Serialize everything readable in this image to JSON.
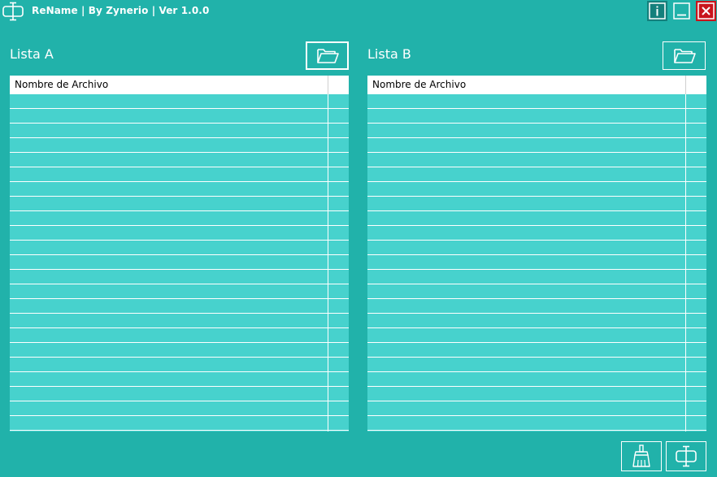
{
  "window": {
    "title": "ReName | By Zynerio | Ver 1.0.0",
    "controls": {
      "info": "info-icon",
      "minimize": "minimize-icon",
      "close": "close-icon"
    }
  },
  "list_a": {
    "title": "Lista A",
    "open_button_icon": "folder-open-icon",
    "columns": [
      "Nombre de Archivo",
      ""
    ],
    "rows": []
  },
  "list_b": {
    "title": "Lista B",
    "open_button_icon": "folder-open-icon",
    "columns": [
      "Nombre de Archivo",
      ""
    ],
    "rows": []
  },
  "footer": {
    "clear_button_icon": "broom-icon",
    "rename_button_icon": "rename-icon"
  },
  "colors": {
    "background": "#21b2aa",
    "list_background": "#47d2cd",
    "info_button": "#14807c",
    "close_button": "#c8141c"
  }
}
